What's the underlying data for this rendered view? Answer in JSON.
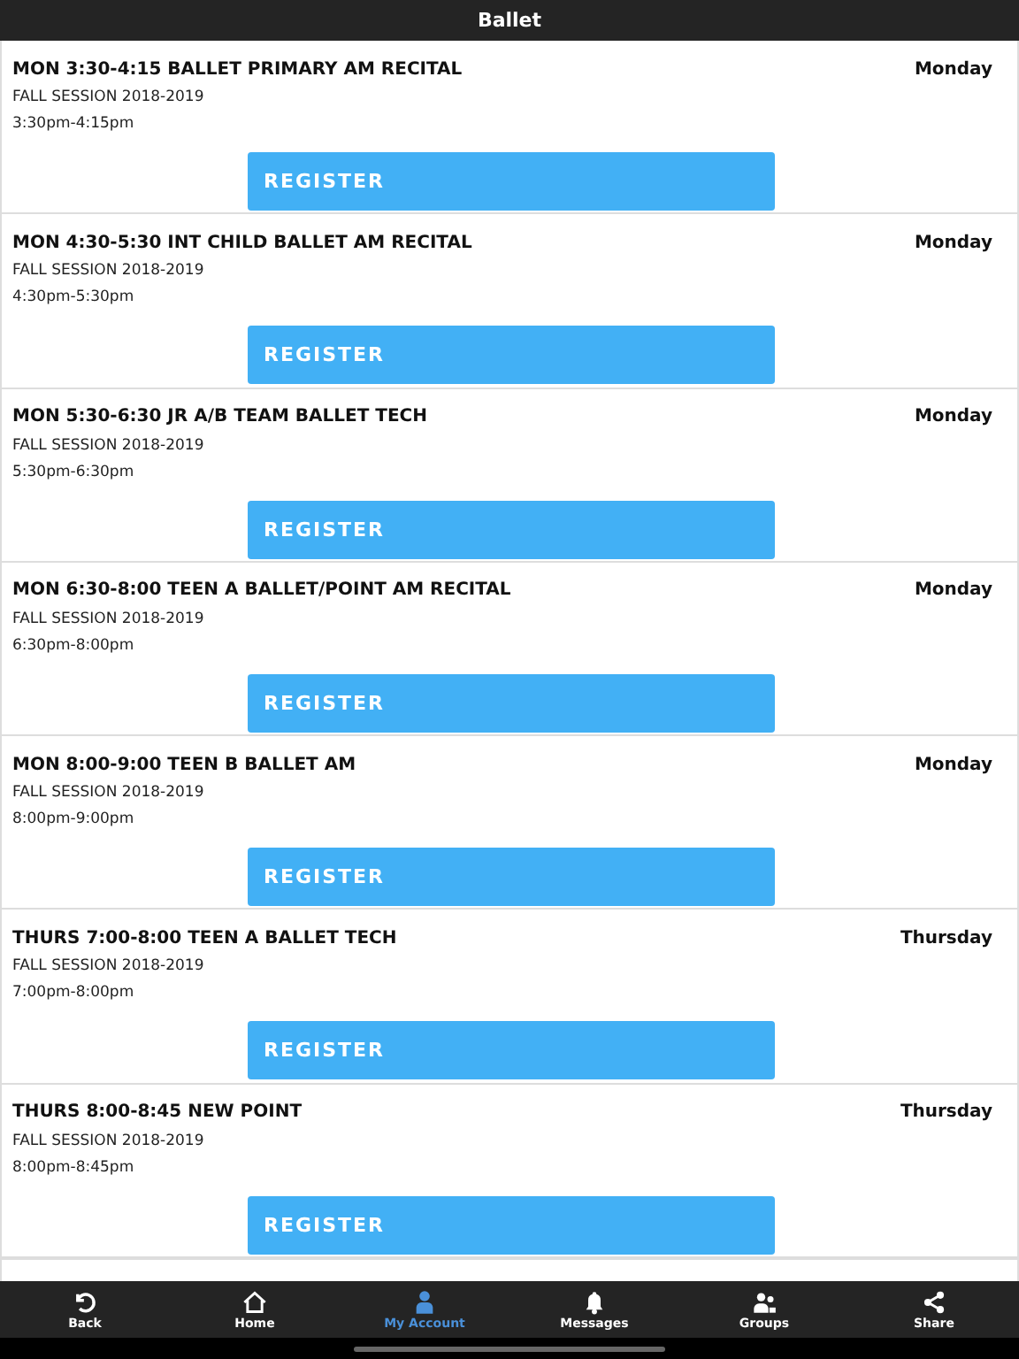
{
  "header": {
    "title": "Ballet"
  },
  "classes": [
    {
      "name": "MON 3:30-4:15 BALLET PRIMARY AM RECITAL",
      "day": "Monday",
      "session": "FALL SESSION 2018-2019",
      "time": "3:30pm-4:15pm",
      "button": "REGISTER"
    },
    {
      "name": "MON 4:30-5:30 INT CHILD BALLET AM RECITAL",
      "day": "Monday",
      "session": "FALL SESSION 2018-2019",
      "time": "4:30pm-5:30pm",
      "button": "REGISTER"
    },
    {
      "name": "MON 5:30-6:30 JR A/B TEAM BALLET TECH",
      "day": "Monday",
      "session": "FALL SESSION 2018-2019",
      "time": "5:30pm-6:30pm",
      "button": "REGISTER"
    },
    {
      "name": "MON 6:30-8:00 TEEN A BALLET/POINT AM RECITAL",
      "day": "Monday",
      "session": "FALL SESSION 2018-2019",
      "time": "6:30pm-8:00pm",
      "button": "REGISTER"
    },
    {
      "name": "MON 8:00-9:00 TEEN B BALLET AM",
      "day": "Monday",
      "session": "FALL SESSION 2018-2019",
      "time": "8:00pm-9:00pm",
      "button": "REGISTER"
    },
    {
      "name": "THURS 7:00-8:00 TEEN A BALLET TECH",
      "day": "Thursday",
      "session": "FALL SESSION 2018-2019",
      "time": "7:00pm-8:00pm",
      "button": "REGISTER"
    },
    {
      "name": "THURS 8:00-8:45 NEW POINT",
      "day": "Thursday",
      "session": "FALL SESSION 2018-2019",
      "time": "8:00pm-8:45pm",
      "button": "REGISTER"
    }
  ],
  "tabs": [
    {
      "kind": "back",
      "label": "Back",
      "selected": false
    },
    {
      "kind": "home",
      "label": "Home",
      "selected": false
    },
    {
      "kind": "account",
      "label": "My Account",
      "selected": true
    },
    {
      "kind": "messages",
      "label": "Messages",
      "selected": false
    },
    {
      "kind": "groups",
      "label": "Groups",
      "selected": false
    },
    {
      "kind": "share",
      "label": "Share",
      "selected": false
    }
  ]
}
